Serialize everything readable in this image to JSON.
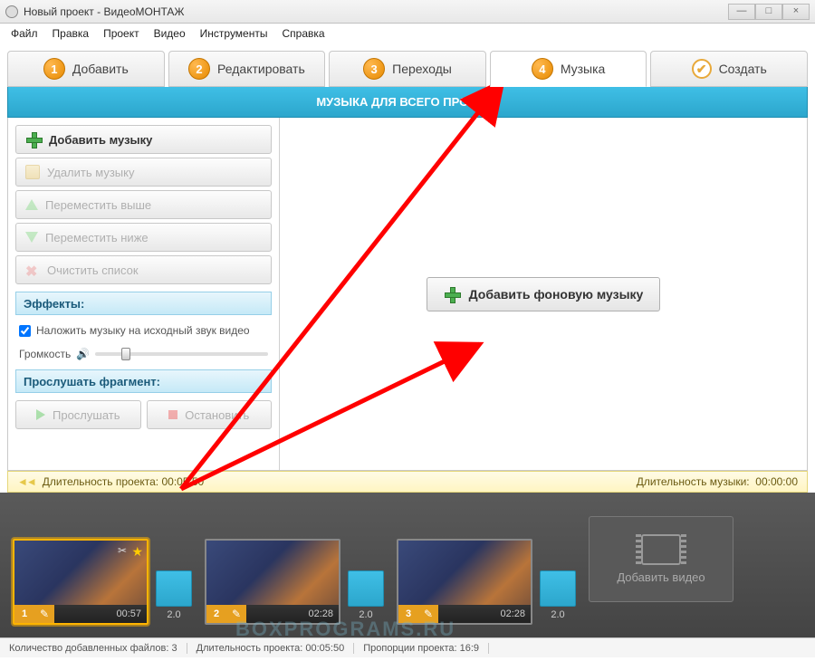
{
  "window": {
    "title": "Новый проект - ВидеоМОНТАЖ"
  },
  "menu": {
    "file": "Файл",
    "edit": "Правка",
    "project": "Проект",
    "video": "Видео",
    "tools": "Инструменты",
    "help": "Справка"
  },
  "tabs": {
    "t1": "Добавить",
    "t2": "Редактировать",
    "t3": "Переходы",
    "t4": "Музыка",
    "t5": "Создать"
  },
  "band": "МУЗЫКА ДЛЯ ВСЕГО ПРОЕКТА",
  "sidebar": {
    "add": "Добавить музыку",
    "delete": "Удалить музыку",
    "up": "Переместить выше",
    "down": "Переместить ниже",
    "clear": "Очистить список",
    "effects": "Эффекты:",
    "overlay": "Наложить музыку на исходный звук видео",
    "volume": "Громкость",
    "preview": "Прослушать фрагмент:",
    "play": "Прослушать",
    "stop": "Остановить"
  },
  "canvas": {
    "add_bg": "Добавить фоновую музыку"
  },
  "duration": {
    "project_label": "Длительность проекта:",
    "project_value": "00:05:50",
    "music_label": "Длительность музыки:",
    "music_value": "00:00:00"
  },
  "timeline": {
    "clips": [
      {
        "num": "1",
        "time": "00:57",
        "selected": true,
        "star": true
      },
      {
        "num": "2",
        "time": "02:28"
      },
      {
        "num": "3",
        "time": "02:28"
      }
    ],
    "transition": "2.0",
    "add_video": "Добавить видео"
  },
  "status": {
    "files_label": "Количество добавленных файлов:",
    "files_value": "3",
    "dur_label": "Длительность проекта:",
    "dur_value": "00:05:50",
    "ratio_label": "Пропорции проекта:",
    "ratio_value": "16:9"
  },
  "watermark": "BOXPROGRAMS.RU"
}
